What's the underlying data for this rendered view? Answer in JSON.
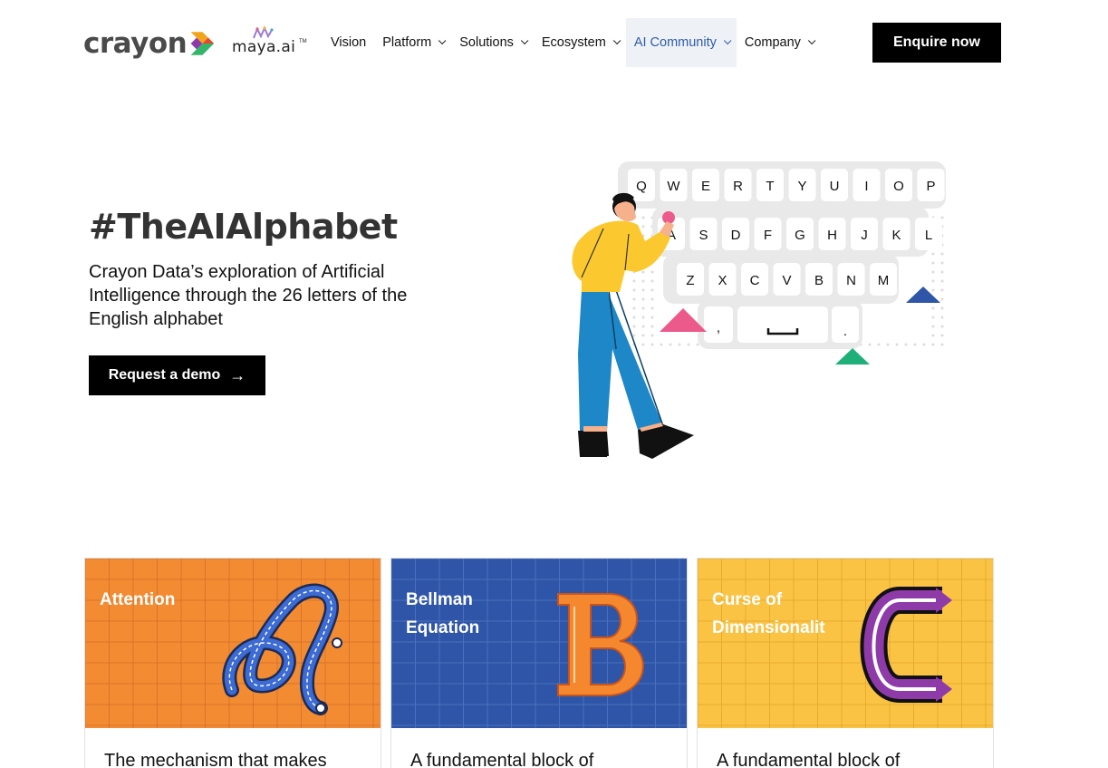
{
  "brand": {
    "logo_text": "crayon",
    "maya_text": "maya.ai",
    "maya_tm": "TM"
  },
  "nav": {
    "items": [
      {
        "label": "Vision",
        "has_menu": false
      },
      {
        "label": "Platform",
        "has_menu": true
      },
      {
        "label": "Solutions",
        "has_menu": true
      },
      {
        "label": "Ecosystem",
        "has_menu": true
      },
      {
        "label": "AI Community",
        "has_menu": true,
        "active": true
      },
      {
        "label": "Company",
        "has_menu": true
      }
    ],
    "cta": "Enquire now"
  },
  "hero": {
    "title": "#TheAIAlphabet",
    "subtitle": "Crayon Data’s exploration of Artificial Intelligence through the 26 letters of the English alphabet",
    "button": "Request a demo",
    "keyboard": {
      "row1": [
        "Q",
        "W",
        "E",
        "R",
        "T",
        "Y",
        "U",
        "I",
        "O",
        "P"
      ],
      "row2": [
        "A",
        "S",
        "D",
        "F",
        "G",
        "H",
        "J",
        "K",
        "L"
      ],
      "row3": [
        "Z",
        "X",
        "C",
        "V",
        "B",
        "N",
        "M"
      ],
      "comma": ",",
      "period": "."
    }
  },
  "cards": [
    {
      "label": "Attention",
      "letter": "A",
      "desc": "The mechanism that makes",
      "color": "#f38b32"
    },
    {
      "label": "Bellman\nEquation",
      "letter": "B",
      "desc": "A fundamental block of",
      "color": "#2e55a7"
    },
    {
      "label": "Curse of\nDimensionalit",
      "letter": "C",
      "desc": "A fundamental block of",
      "color": "#fbc344"
    }
  ],
  "colors": {
    "active_nav": "#2f5ca8",
    "button_bg": "#000000"
  }
}
